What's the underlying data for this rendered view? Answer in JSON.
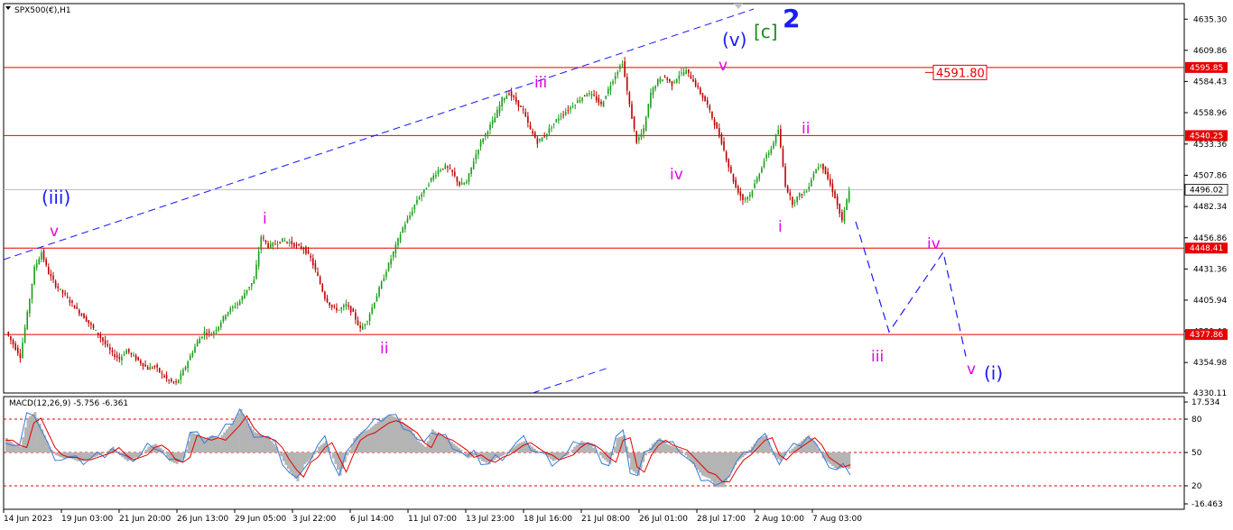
{
  "chart_data": [
    {
      "type": "candlestick",
      "title": "SPX500(€),H1",
      "ylim": [
        4330.11,
        4648.0
      ],
      "y_ticks": [
        "4635.30",
        "4609.86",
        "4584.43",
        "4558.96",
        "4533.36",
        "4507.86",
        "4482.34",
        "4456.86",
        "4431.36",
        "4405.94",
        "4380.46",
        "4354.98",
        "4330.11"
      ],
      "x_ticks": [
        "14 Jun 2023",
        "19 Jun 03:00",
        "21 Jun 20:00",
        "26 Jun 13:00",
        "29 Jun 05:00",
        "3 Jul 22:00",
        "6 Jul 14:00",
        "11 Jul 07:00",
        "13 Jul 23:00",
        "18 Jul 16:00",
        "21 Jul 08:00",
        "26 Jul 01:00",
        "28 Jul 17:00",
        "2 Aug 10:00",
        "7 Aug 03:00"
      ],
      "current_price": "4496.02",
      "price_path": [
        4380,
        4370,
        4360,
        4395,
        4432,
        4445,
        4428,
        4418,
        4412,
        4405,
        4398,
        4392,
        4385,
        4378,
        4370,
        4362,
        4358,
        4365,
        4360,
        4355,
        4350,
        4352,
        4345,
        4340,
        4338,
        4348,
        4360,
        4372,
        4380,
        4378,
        4385,
        4395,
        4400,
        4405,
        4415,
        4422,
        4458,
        4450,
        4452,
        4455,
        4453,
        4450,
        4448,
        4440,
        4425,
        4408,
        4400,
        4398,
        4402,
        4395,
        4382,
        4390,
        4405,
        4420,
        4435,
        4450,
        4465,
        4475,
        4488,
        4495,
        4505,
        4512,
        4515,
        4510,
        4500,
        4502,
        4520,
        4535,
        4545,
        4555,
        4570,
        4575,
        4568,
        4560,
        4545,
        4535,
        4540,
        4548,
        4555,
        4560,
        4565,
        4570,
        4575,
        4572,
        4565,
        4578,
        4590,
        4600,
        4565,
        4535,
        4545,
        4575,
        4585,
        4588,
        4582,
        4590,
        4593,
        4585,
        4575,
        4565,
        4550,
        4535,
        4515,
        4498,
        4488,
        4492,
        4505,
        4520,
        4530,
        4545,
        4500,
        4485,
        4492,
        4495,
        4510,
        4518,
        4505,
        4490,
        4470,
        4496
      ],
      "horizontal_levels": [
        {
          "value": 4595.85,
          "label": "4595.85",
          "color": "#e60000"
        },
        {
          "value": 4540.25,
          "label": "4540.25",
          "color": "#e60000"
        },
        {
          "value": 4448.41,
          "label": "4448.41",
          "color": "#e60000"
        },
        {
          "value": 4377.86,
          "label": "4377.86",
          "color": "#e60000"
        }
      ],
      "price_marker_label": "4591.80",
      "wave_labels": [
        {
          "text": "(iii)",
          "color": "#1a1aff",
          "big": false
        },
        {
          "text": "v",
          "color": "#e600e6",
          "big": false
        },
        {
          "text": "i",
          "color": "#e600e6",
          "big": false
        },
        {
          "text": "ii",
          "color": "#e600e6",
          "big": false
        },
        {
          "text": "iii",
          "color": "#e600e6",
          "big": false
        },
        {
          "text": "iv",
          "color": "#e600e6",
          "big": false
        },
        {
          "text": "v",
          "color": "#e600e6",
          "big": false
        },
        {
          "text": "(v)",
          "color": "#1a1aff",
          "big": false
        },
        {
          "text": "[c]",
          "color": "#1a8c1a",
          "big": false
        },
        {
          "text": "2",
          "color": "#1a1aff",
          "big": true
        },
        {
          "text": "i",
          "color": "#e600e6",
          "big": false
        },
        {
          "text": "ii",
          "color": "#e600e6",
          "big": false
        },
        {
          "text": "iii",
          "color": "#e600e6",
          "big": false
        },
        {
          "text": "iv",
          "color": "#e600e6",
          "big": false
        },
        {
          "text": "v",
          "color": "#e600e6",
          "big": false
        },
        {
          "text": "(i)",
          "color": "#1a1aff",
          "big": false
        }
      ],
      "projection_path": [
        4470,
        4380,
        4445,
        4360
      ],
      "colors": {
        "up": "#1a9e1a",
        "down": "#c00000",
        "level": "#e60000",
        "trend": "#1a1aff"
      }
    },
    {
      "type": "macd",
      "title": "MACD(12,26,9) -5.756 -6.361",
      "ylim": [
        -16.463,
        17.534
      ],
      "y_ticks": [
        "17.534",
        "80",
        "50",
        "20",
        "-16.463"
      ],
      "hist_path": [
        5,
        3,
        2,
        12,
        14,
        8,
        2,
        -1,
        -2,
        -2,
        -3,
        -3,
        -2,
        -1,
        0,
        2,
        -1,
        -3,
        -2,
        -1,
        2,
        3,
        1,
        -3,
        -4,
        -2,
        7,
        6,
        5,
        6,
        5,
        8,
        11,
        15,
        10,
        7,
        6,
        5,
        2,
        -3,
        -7,
        -10,
        -4,
        -2,
        2,
        4,
        -2,
        -8,
        -1,
        5,
        7,
        8,
        10,
        12,
        13,
        12,
        10,
        8,
        4,
        2,
        8,
        6,
        5,
        3,
        1,
        -2,
        -1,
        -3,
        -4,
        -2,
        -1,
        1,
        3,
        4,
        2,
        0,
        -1,
        -3,
        -2,
        -1,
        2,
        4,
        3,
        1,
        -2,
        -4,
        5,
        6,
        -6,
        -8,
        -1,
        3,
        5,
        3,
        2,
        1,
        -2,
        -5,
        -8,
        -9,
        -12,
        -12,
        -7,
        -3,
        -1,
        2,
        5,
        6,
        -1,
        -3,
        0,
        2,
        4,
        6,
        3,
        -2,
        -4,
        -6,
        -5,
        -6
      ],
      "ref_levels": [
        80,
        50,
        20
      ]
    }
  ]
}
